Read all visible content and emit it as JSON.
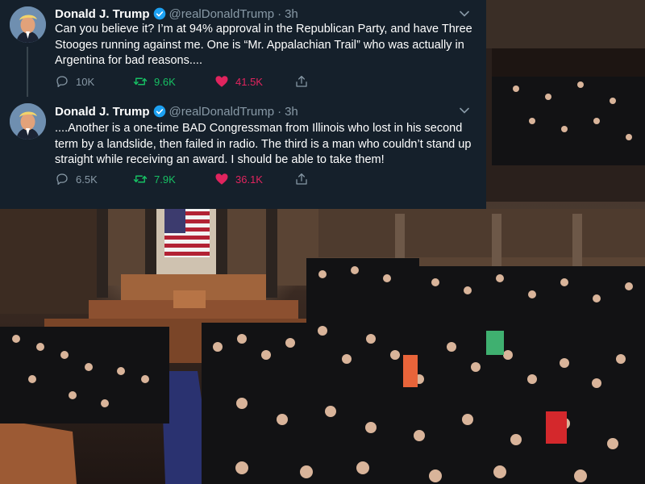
{
  "colors": {
    "panel_bg": "#15202b",
    "muted": "#8899a6",
    "retweet_active": "#17bf63",
    "like_active": "#e0245e",
    "verified": "#1da1f2"
  },
  "tweets": [
    {
      "display_name": "Donald J. Trump",
      "handle": "@realDonaldTrump",
      "separator": "·",
      "time": "3h",
      "text": "Can you believe it? I’m at 94% approval in the Republican Party, and have Three Stooges running against me. One is “Mr. Appalachian Trail” who was actually in Argentina for bad reasons....",
      "replies": "10K",
      "retweets": "9.6K",
      "likes": "41.5K",
      "retweeted": true,
      "liked": true
    },
    {
      "display_name": "Donald J. Trump",
      "handle": "@realDonaldTrump",
      "separator": "·",
      "time": "3h",
      "text": "....Another is a one-time BAD Congressman from Illinois who lost in his second term by a landslide, then failed in radio. The third is a man who couldn’t stand up straight while receiving an award. I should be able to take them!",
      "replies": "6.5K",
      "retweets": "7.9K",
      "likes": "36.1K",
      "retweeted": true,
      "liked": true
    }
  ],
  "icons": {
    "avatar": "avatar-portrait",
    "verified": "verified-badge-icon",
    "more": "chevron-down-icon",
    "reply": "reply-icon",
    "retweet": "retweet-icon",
    "like": "heart-icon",
    "share": "share-icon"
  }
}
